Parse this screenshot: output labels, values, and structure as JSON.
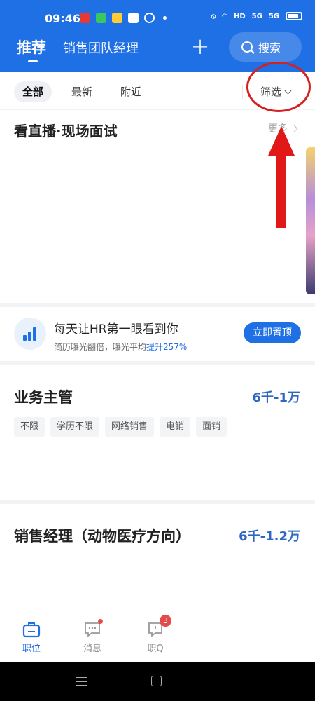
{
  "status_bar": {
    "time": "09:46",
    "sys_labels": [
      "HD",
      "5G",
      "5G"
    ]
  },
  "header": {
    "tabs": [
      "推荐",
      "销售团队经理"
    ],
    "plus_label": "+",
    "search_label": "搜索"
  },
  "filter_bar": {
    "chips": [
      "全部",
      "最新",
      "附近"
    ],
    "filter_label": "筛选"
  },
  "live_section": {
    "title": "看直播·现场面试",
    "more_label": "更多"
  },
  "promo": {
    "title": "每天让HR第一眼看到你",
    "subtitle_prefix": "简历曝光翻倍，曝光平均",
    "subtitle_highlight": "提升257%",
    "button_label": "立即置顶"
  },
  "jobs": [
    {
      "title": "业务主管",
      "salary": "6千-1万",
      "tags": [
        "不限",
        "学历不限",
        "网络销售",
        "电销",
        "面销"
      ]
    },
    {
      "title": "销售经理（动物医疗方向）",
      "salary": "6千-1.2万",
      "tags": []
    }
  ],
  "bottom_nav": {
    "items": [
      {
        "label": "职位",
        "icon": "briefcase-icon"
      },
      {
        "label": "消息",
        "icon": "chat-icon"
      },
      {
        "label": "职Q",
        "icon": "qa-bubble-icon",
        "badge": "3"
      }
    ]
  },
  "colors": {
    "brand": "#1f6fe5",
    "salary": "#2d67c2",
    "annotation": "#d62020"
  }
}
